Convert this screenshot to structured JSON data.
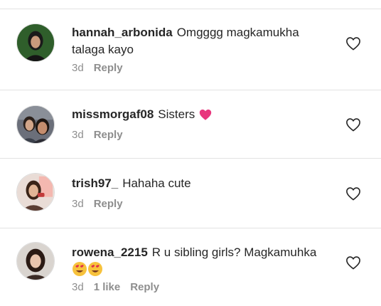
{
  "comments": [
    {
      "username": "hannah_arbonida",
      "text": "Omgggg magkamukha talaga kayo",
      "time": "3d",
      "likes": "",
      "reply_label": "Reply",
      "avatar_icon": "profile-photo"
    },
    {
      "username": "missmorgaf08",
      "text": "Sisters",
      "emoji": "💗",
      "emoji_icon": "pink-heart-icon",
      "time": "3d",
      "likes": "",
      "reply_label": "Reply",
      "avatar_icon": "profile-photo"
    },
    {
      "username": "trish97_",
      "text": "Hahaha cute",
      "time": "3d",
      "likes": "",
      "reply_label": "Reply",
      "avatar_icon": "profile-photo"
    },
    {
      "username": "rowena_2215",
      "text": "R u sibling girls? Magkamuhka",
      "emoji": "😍😍",
      "emoji_icon": "heart-eyes-emoji",
      "time": "3d",
      "likes": "1 like",
      "reply_label": "Reply",
      "avatar_icon": "profile-photo"
    }
  ],
  "colors": {
    "text": "#262626",
    "meta": "#8e8e8e",
    "divider": "#e2e2e2",
    "heart_emoji": "#e8367d"
  }
}
